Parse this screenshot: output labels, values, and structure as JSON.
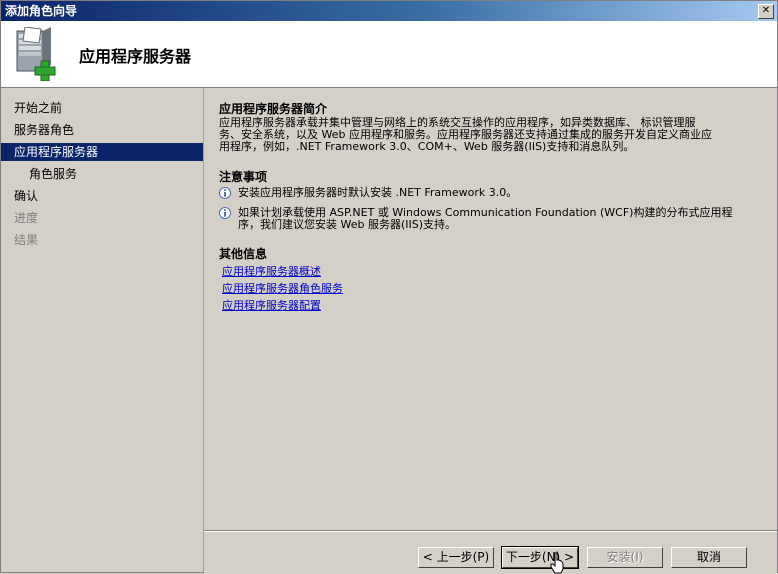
{
  "window": {
    "title": "添加角色向导",
    "close_label": "✕"
  },
  "header": {
    "title": "应用程序服务器",
    "icon": "server-role-add-icon"
  },
  "sidebar": {
    "items": [
      {
        "label": "开始之前",
        "state": "normal"
      },
      {
        "label": "服务器角色",
        "state": "normal"
      },
      {
        "label": "应用程序服务器",
        "state": "active"
      },
      {
        "label": "角色服务",
        "state": "sub"
      },
      {
        "label": "确认",
        "state": "normal"
      },
      {
        "label": "进度",
        "state": "disabled"
      },
      {
        "label": "结果",
        "state": "disabled"
      }
    ]
  },
  "content": {
    "intro_title": "应用程序服务器简介",
    "intro_line1": "应用程序服务器承载并集中管理与网络上的系统交互操作的应用程序，如异类数据库、 标识管理服",
    "intro_line2": "务、安全系统，以及 Web 应用程序和服务。应用程序服务器还支持通过集成的服务开发自定义商业应",
    "intro_line3": "用程序，例如，.NET Framework 3.0、COM+、Web 服务器(IIS)支持和消息队列。",
    "notes_title": "注意事项",
    "note1": "安装应用程序服务器时默认安装 .NET Framework 3.0。",
    "note2_line1": "如果计划承载使用 ASP.NET 或 Windows Communication Foundation (WCF)构建的分布式应用程",
    "note2_line2": "序，我们建议您安装 Web 服务器(IIS)支持。",
    "more_title": "其他信息",
    "links": [
      "应用程序服务器概述",
      "应用程序服务器角色服务",
      "应用程序服务器配置"
    ],
    "info_icon": "info-icon"
  },
  "footer": {
    "prev_label": "< 上一步(P)",
    "next_label": "下一步(N) >",
    "install_label": "安装(I)",
    "cancel_label": "取消"
  }
}
